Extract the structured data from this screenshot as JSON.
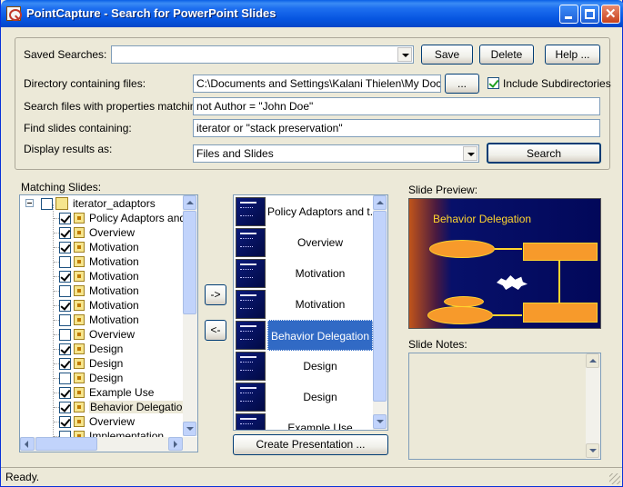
{
  "window": {
    "title": "PointCapture - Search for PowerPoint Slides"
  },
  "top": {
    "saved_searches_label": "Saved Searches:",
    "saved_searches_value": "",
    "save_label": "Save",
    "delete_label": "Delete",
    "help_label": "Help ...",
    "directory_label": "Directory containing files:",
    "directory_value": "C:\\Documents and Settings\\Kalani Thielen\\My Documents",
    "browse_label": "...",
    "include_subdirs_label": "Include Subdirectories",
    "include_subdirs_checked": true,
    "properties_label": "Search files with properties matching:",
    "properties_value": "not Author = \"John Doe\"",
    "find_label": "Find slides containing:",
    "find_value": "iterator or \"stack preservation\"",
    "display_label": "Display results as:",
    "display_value": "Files and Slides",
    "search_label": "Search"
  },
  "matching": {
    "label": "Matching Slides:",
    "root": "iterator_adaptors",
    "items": [
      {
        "label": "Policy Adaptors and t",
        "checked": true
      },
      {
        "label": "Overview",
        "checked": true
      },
      {
        "label": "Motivation",
        "checked": true
      },
      {
        "label": "Motivation",
        "checked": false
      },
      {
        "label": "Motivation",
        "checked": true
      },
      {
        "label": "Motivation",
        "checked": false
      },
      {
        "label": "Motivation",
        "checked": true
      },
      {
        "label": "Motivation",
        "checked": false
      },
      {
        "label": "Overview",
        "checked": false
      },
      {
        "label": "Design",
        "checked": true
      },
      {
        "label": "Design",
        "checked": true
      },
      {
        "label": "Design",
        "checked": false
      },
      {
        "label": "Example Use",
        "checked": true
      },
      {
        "label": "Behavior Delegation",
        "checked": true
      },
      {
        "label": "Overview",
        "checked": true
      },
      {
        "label": "Implementation",
        "checked": false
      }
    ]
  },
  "transfer": {
    "add_label": "->",
    "remove_label": "<-"
  },
  "slides": {
    "items": [
      "Policy Adaptors and t...",
      "Overview",
      "Motivation",
      "Motivation",
      "Behavior Delegation",
      "Design",
      "Design",
      "Example Use"
    ],
    "selected_index": 4,
    "create_label": "Create Presentation ..."
  },
  "preview": {
    "label": "Slide Preview:",
    "slide_title": "Behavior Delegation",
    "notes_label": "Slide Notes:"
  },
  "status": {
    "text": "Ready."
  },
  "colors": {
    "selection": "#316ac5",
    "titlebar": "#0655e0",
    "slide_title": "#ffd52e"
  }
}
